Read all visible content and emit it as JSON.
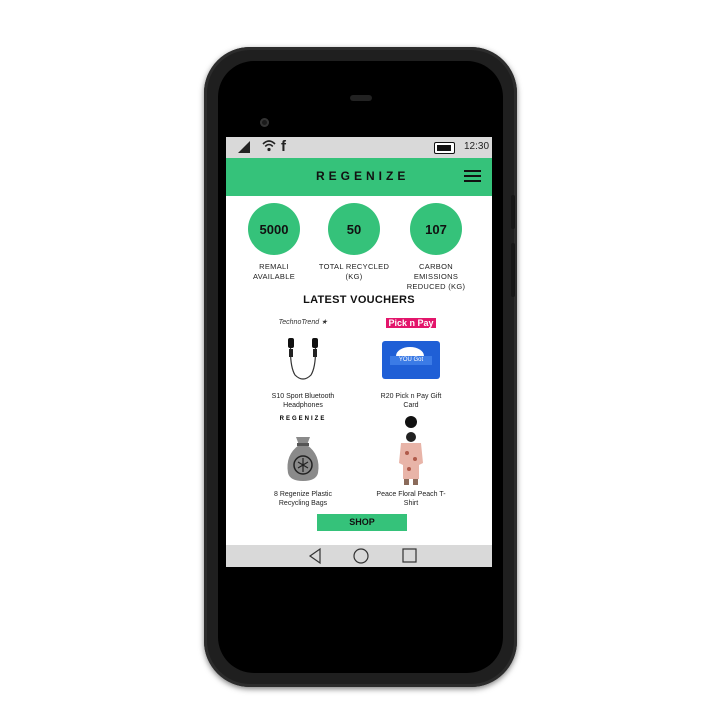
{
  "status_bar": {
    "time": "12:30",
    "icons": [
      "signal-icon",
      "wifi-icon",
      "facebook-icon",
      "battery-icon"
    ]
  },
  "header": {
    "logo_text": "REGENIZE",
    "menu_icon": "hamburger-menu-icon"
  },
  "stats": [
    {
      "value": "5000",
      "label_line1": "REMALI",
      "label_line2": "AVAILABLE"
    },
    {
      "value": "50",
      "label_line1": "TOTAL RECYCLED",
      "label_line2": "(KG)"
    },
    {
      "value": "107",
      "label_line1": "CARBON EMISSIONS",
      "label_line2": "REDUCED (KG)"
    }
  ],
  "vouchers_title": "LATEST VOUCHERS",
  "vouchers": [
    {
      "brand": "TechnoTrend",
      "name_line1": "S10 Sport Bluetooth",
      "name_line2": "Headphones",
      "image": "headphones"
    },
    {
      "brand": "Pick n Pay",
      "name_line1": "R20 Pick n Pay Gift",
      "name_line2": "Card",
      "image": "gift-card",
      "card_text": "YOU Got"
    },
    {
      "brand": "REGENIZE",
      "name_line1": "8 Regenize Plastic",
      "name_line2": "Recycling Bags",
      "image": "recycling-bag"
    },
    {
      "brand": "",
      "name_line1": "Peace Floral Peach T-",
      "name_line2": "Shirt",
      "image": "t-shirt"
    }
  ],
  "shop_button": "SHOP",
  "nav_icons": [
    "back-icon",
    "home-icon",
    "recents-icon"
  ],
  "colors": {
    "accent": "#35c27a",
    "bar_gray": "#d9d9d9",
    "phone": "#1f1f1f"
  }
}
